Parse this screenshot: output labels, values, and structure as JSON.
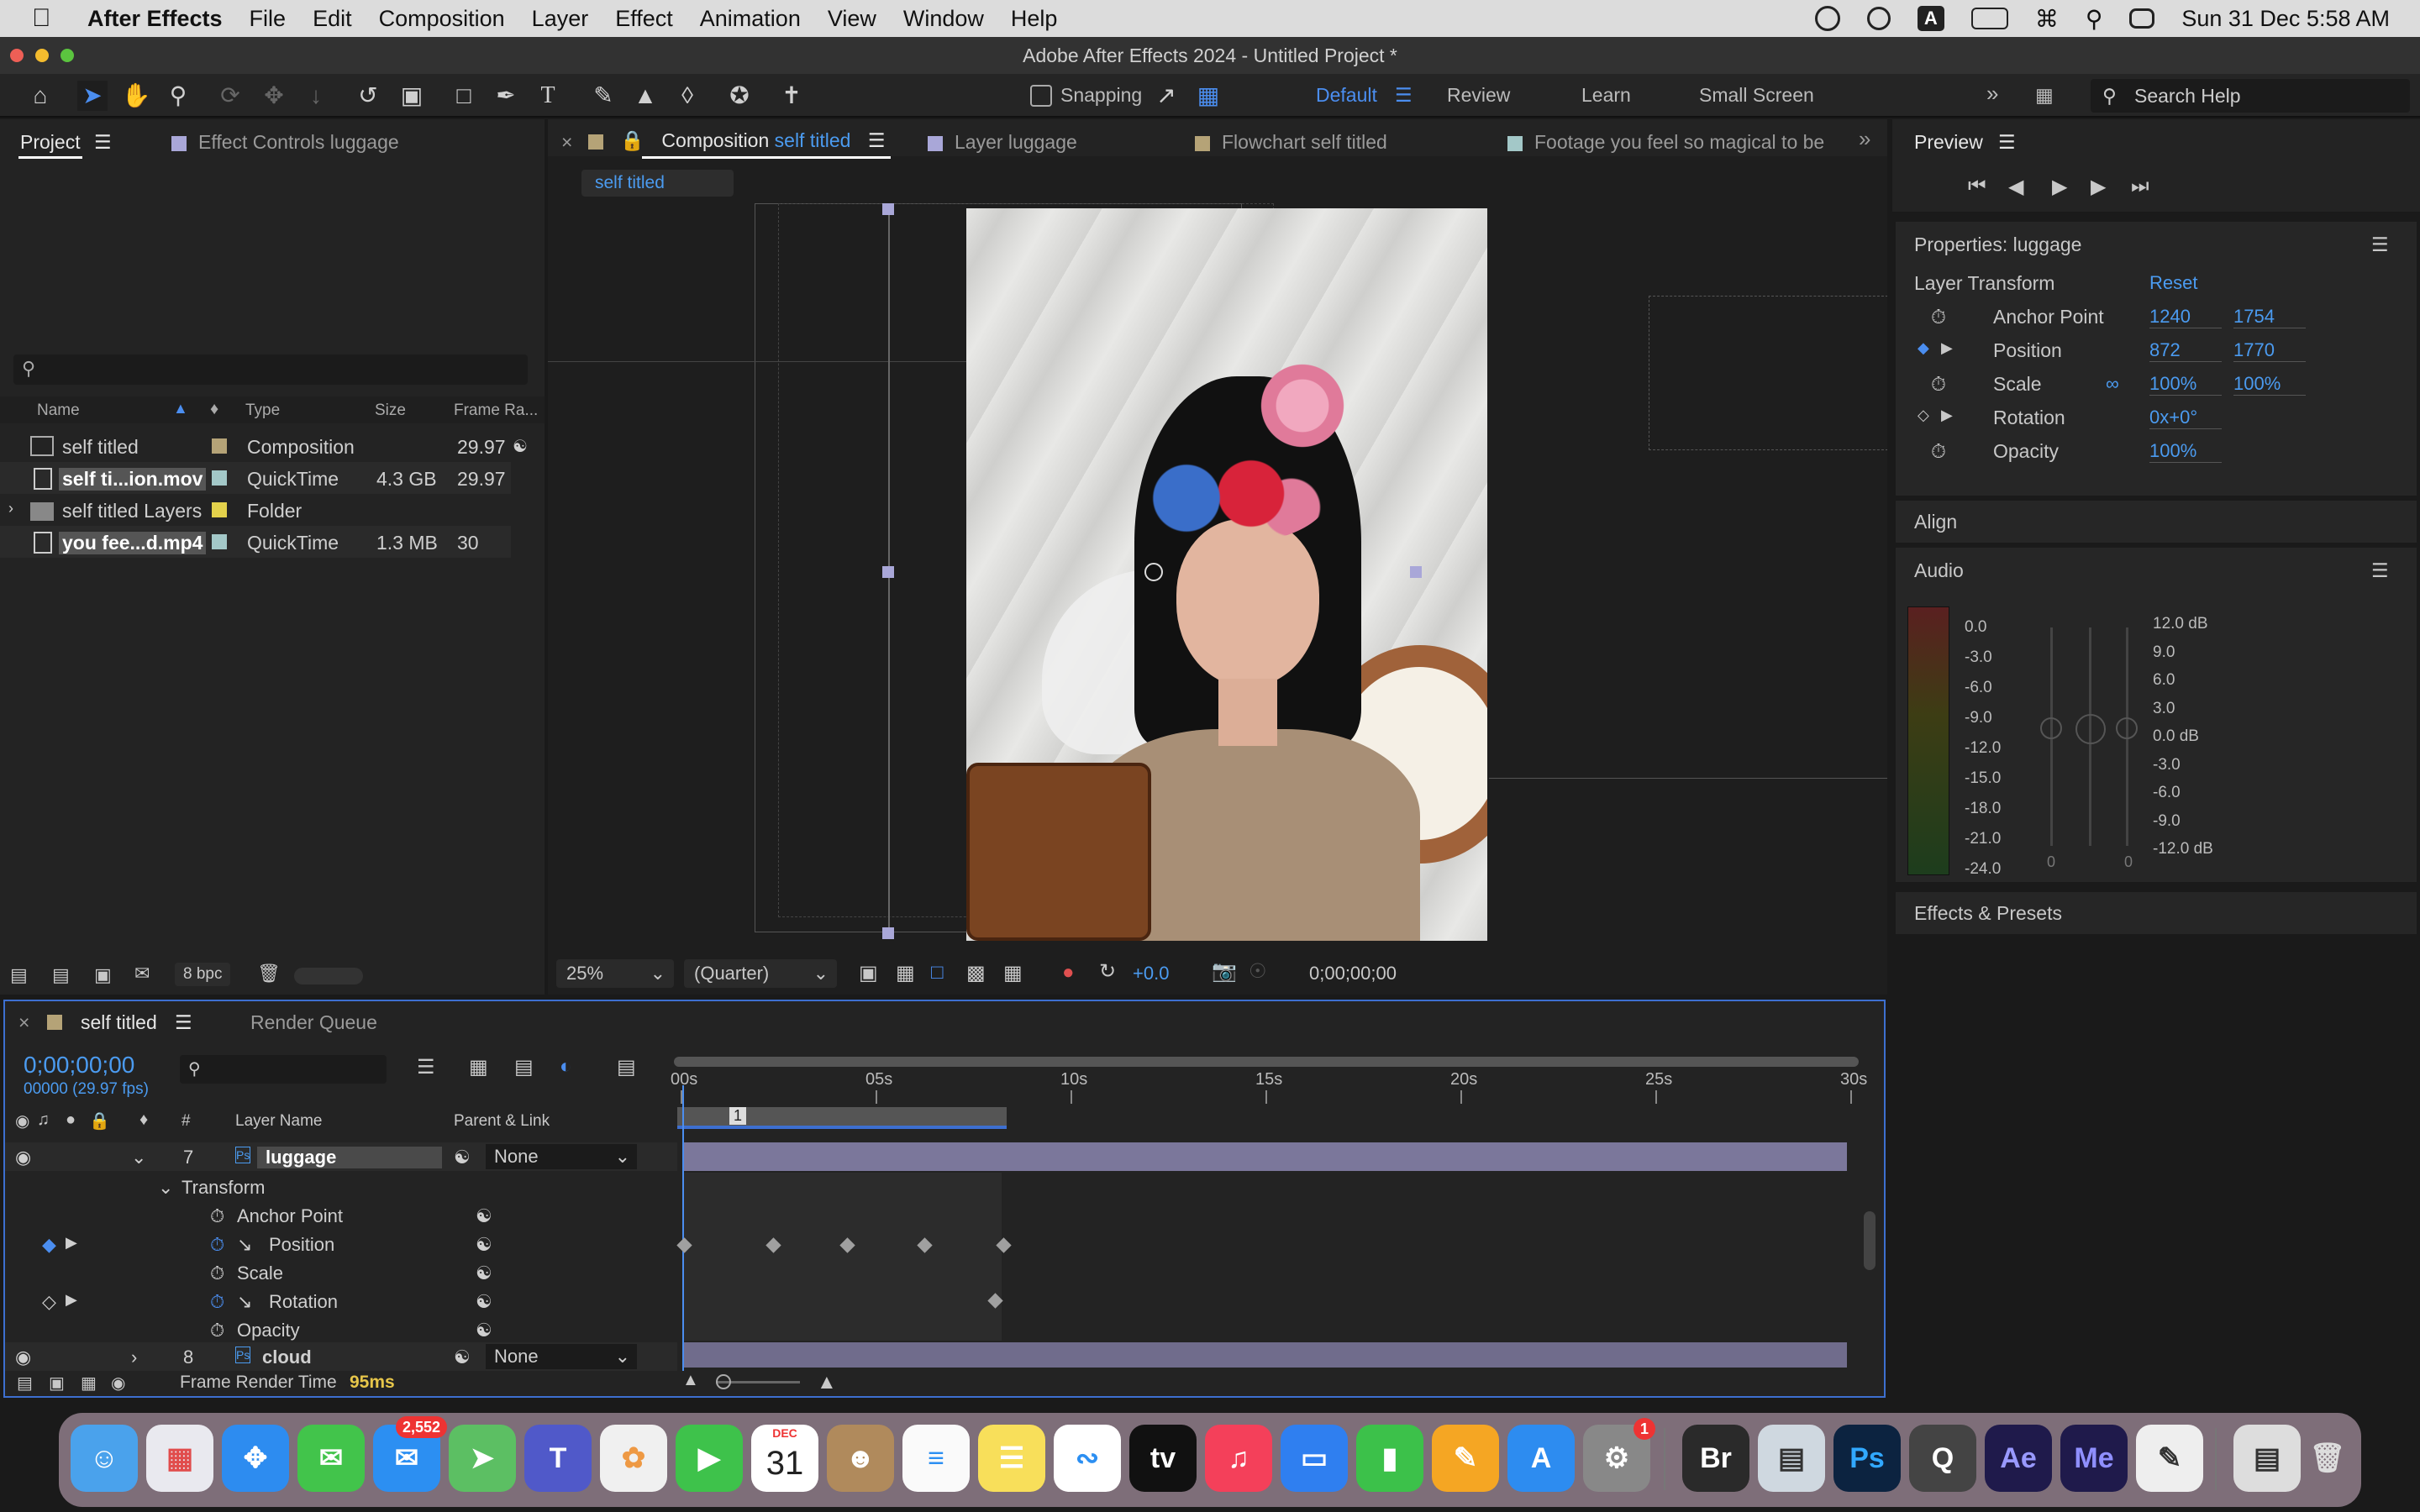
{
  "menubar": {
    "app": "After Effects",
    "items": [
      "File",
      "Edit",
      "Composition",
      "Layer",
      "Effect",
      "Animation",
      "View",
      "Window",
      "Help"
    ],
    "clock": "Sun 31 Dec  5:58 AM",
    "input_source": "A"
  },
  "window_title": "Adobe After Effects 2024 - Untitled Project *",
  "toolbar": {
    "snapping_label": "Snapping",
    "workspaces": [
      "Default",
      "Review",
      "Learn",
      "Small Screen"
    ],
    "active_workspace": "Default",
    "search_placeholder": "Search Help"
  },
  "project_panel": {
    "tab_project": "Project",
    "tab_effect_controls": "Effect Controls luggage",
    "columns": [
      "Name",
      "Type",
      "Size",
      "Frame Ra..."
    ],
    "items": [
      {
        "name": "self titled",
        "type": "Composition",
        "size": "",
        "fps": "29.97",
        "swatch": "#b5a377"
      },
      {
        "name": "self ti...ion.mov",
        "type": "QuickTime",
        "size": "4.3 GB",
        "fps": "29.97",
        "swatch": "#a3c8c8"
      },
      {
        "name": "self titled Layers",
        "type": "Folder",
        "size": "",
        "fps": "",
        "swatch": "#e3d14b"
      },
      {
        "name": "you fee...d.mp4",
        "type": "QuickTime",
        "size": "1.3 MB",
        "fps": "30",
        "swatch": "#a3c8c8"
      }
    ],
    "bpc": "8 bpc"
  },
  "viewer": {
    "tabs": [
      {
        "label": "Composition",
        "highlight": "self titled"
      },
      {
        "label": "Layer luggage"
      },
      {
        "label": "Flowchart self titled"
      },
      {
        "label": "Footage you feel so magical to be"
      }
    ],
    "breadcrumb": "self titled",
    "zoom": "25%",
    "resolution": "(Quarter)",
    "exposure": "+0.0",
    "timecode": "0;00;00;00"
  },
  "preview_panel": {
    "title": "Preview"
  },
  "properties_panel": {
    "title": "Properties: luggage",
    "section": "Layer Transform",
    "reset": "Reset",
    "props": [
      {
        "name": "Anchor Point",
        "v1": "1240",
        "v2": "1754"
      },
      {
        "name": "Position",
        "v1": "872",
        "v2": "1770"
      },
      {
        "name": "Scale",
        "v1": "100%",
        "v2": "100%"
      },
      {
        "name": "Rotation",
        "v1": "0x+0°",
        "v2": ""
      },
      {
        "name": "Opacity",
        "v1": "100%",
        "v2": ""
      }
    ]
  },
  "align_panel": {
    "title": "Align"
  },
  "audio_panel": {
    "title": "Audio",
    "left_scale": [
      "0.0",
      "-3.0",
      "-6.0",
      "-9.0",
      "-12.0",
      "-15.0",
      "-18.0",
      "-21.0",
      "-24.0"
    ],
    "right_scale": [
      "12.0 dB",
      "9.0",
      "6.0",
      "3.0",
      "0.0 dB",
      "-3.0",
      "-6.0",
      "-9.0",
      "-12.0 dB"
    ],
    "fader_left": "0",
    "fader_right": "0"
  },
  "effects_panel": {
    "title": "Effects & Presets"
  },
  "timeline": {
    "comp_tab": "self titled",
    "render_tab": "Render Queue",
    "timecode": "0;00;00;00",
    "fps_info": "00000 (29.97 fps)",
    "col_layer_name": "Layer Name",
    "col_parent": "Parent & Link",
    "ruler": [
      "00s",
      "05s",
      "10s",
      "15s",
      "20s",
      "25s",
      "30s"
    ],
    "marker": "1",
    "layers": [
      {
        "num": "7",
        "name": "luggage",
        "parent": "None"
      },
      {
        "num": "8",
        "name": "cloud",
        "parent": "None"
      }
    ],
    "transform_label": "Transform",
    "transform_props": [
      "Anchor Point",
      "Position",
      "Scale",
      "Rotation",
      "Opacity"
    ],
    "frame_render_label": "Frame Render Time",
    "frame_render_value": "95ms"
  },
  "dock": {
    "mail_badge": "2,552",
    "calendar_month": "DEC",
    "calendar_day": "31",
    "settings_badge": "1",
    "apps": [
      "Finder",
      "Launchpad",
      "Safari",
      "Messages",
      "Mail",
      "Maps",
      "Teams",
      "Photos",
      "FaceTime",
      "Calendar",
      "Contacts",
      "Reminders",
      "Notes",
      "Freeform",
      "TV",
      "Music",
      "Keynote",
      "Numbers",
      "Pages",
      "App Store",
      "System Settings",
      "Adobe Bridge",
      "Preview",
      "Photoshop",
      "QuickTime",
      "After Effects",
      "Media Encoder",
      "TextEdit",
      "Image",
      "Trash"
    ]
  }
}
